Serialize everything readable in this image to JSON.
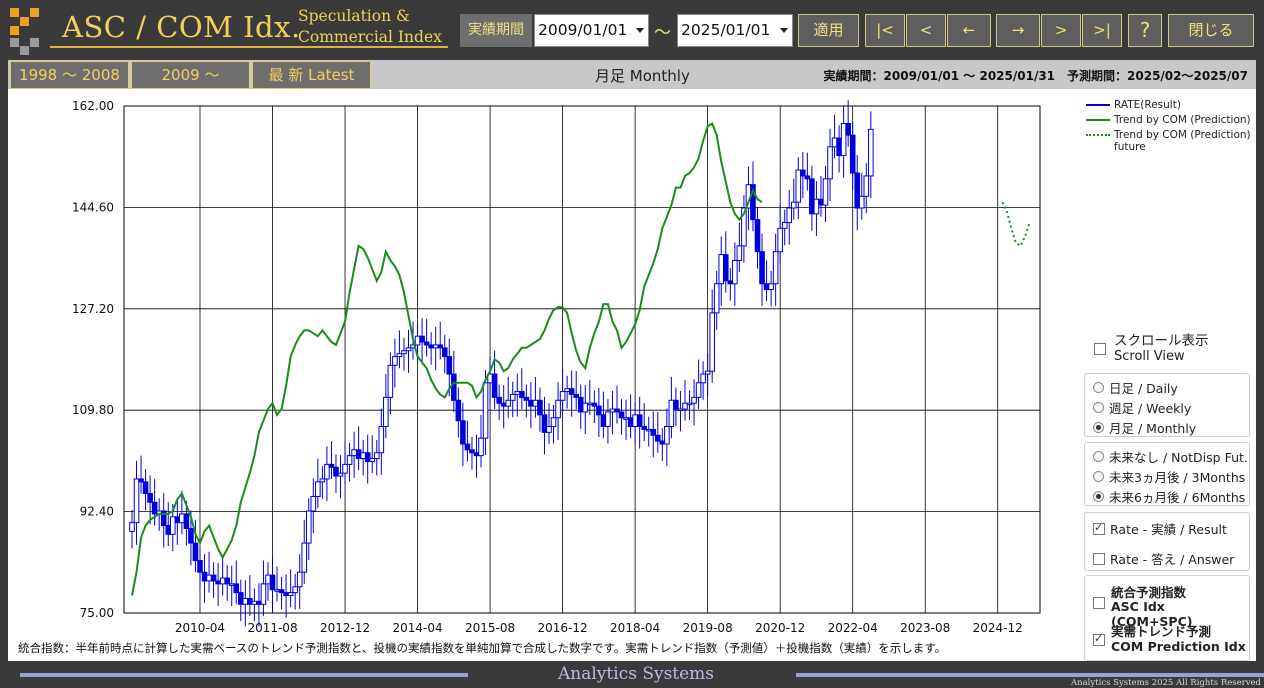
{
  "header": {
    "app_title": "ASC / COM Idx.",
    "subtitle_line1": "Speculation &",
    "subtitle_line2": "Commercial Index",
    "period_label": "実績期間",
    "start_date": "2009/01/01",
    "end_date": "2025/01/01",
    "tilde": "～",
    "apply_label": "適用",
    "nav_first": "|<",
    "nav_prev": "<",
    "nav_back": "←",
    "nav_forward": "→",
    "nav_next": ">",
    "nav_last": ">|",
    "help_label": "?",
    "close_label": "閉じる",
    "logo_colors": [
      "#f0a020",
      "#9a9a9a"
    ]
  },
  "toolbar": {
    "range1": "1998 ～ 2008",
    "range2": "2009 ～",
    "latest": "最 新  Latest",
    "view_label": "月足 Monthly",
    "period_info": "実績期間：2009/01/01 ～ 2025/01/31　予測期間：2025/02～2025/07"
  },
  "legend": {
    "rate": "RATE(Result)",
    "trend": "Trend by COM (Prediction)",
    "trend_future": "Trend by COM (Prediction) future"
  },
  "controls": {
    "scroll_jp": "スクロール表示",
    "scroll_en": "Scroll View",
    "daily": "日足 / Daily",
    "weekly": "週足 / Weekly",
    "monthly": "月足 / Monthly",
    "future_none": "未来なし / NotDisp Fut.",
    "future_3m": "未来3ヵ月後 / 3Months",
    "future_6m": "未来6ヵ月後 / 6Months",
    "rate_result": "Rate - 実績 / Result",
    "rate_answer": "Rate - 答え / Answer",
    "asc_jp": "統合予測指数",
    "asc_en": "ASC Idx (COM+SPC)",
    "com_jp": "実需トレンド予測",
    "com_en": "COM Prediction Idx",
    "scroll_checked": false,
    "period_selected": "monthly",
    "future_selected": "6m",
    "rate_result_checked": true,
    "rate_answer_checked": false,
    "asc_checked": false,
    "com_checked": true
  },
  "footnote": "統合指数：半年前時点に計算した実需ベースのトレンド予測指数と、投機の実績指数を単純加算で合成した数字です。実需トレンド指数（予測値）＋投機指数（実績）を示します。",
  "footer": {
    "company": "Analytics Systems",
    "copyright": "Analytics Systems 2025 All Rights Reserved"
  },
  "chart_data": {
    "type": "line",
    "y_ticks": [
      "162.00",
      "144.60",
      "127.20",
      "109.80",
      "92.40",
      "75.00"
    ],
    "ylim": [
      75,
      162
    ],
    "x_ticks": [
      "2010-04",
      "2011-08",
      "2012-12",
      "2014-04",
      "2015-08",
      "2016-12",
      "2018-04",
      "2019-08",
      "2020-12",
      "2022-04",
      "2023-08",
      "2024-12"
    ],
    "xlim": [
      "2009-01",
      "2025-07"
    ],
    "grid": true,
    "legend_position": "top-right",
    "rate_color": "#0000dd",
    "trend_color": "#1a8c1a",
    "rate_monthly": {
      "start": "2009-01",
      "close": [
        90.5,
        98.0,
        97.5,
        95.5,
        94.0,
        92.0,
        92.5,
        90.0,
        88.5,
        91.5,
        90.5,
        92.0,
        89.5,
        87.0,
        84.0,
        82.0,
        80.5,
        81.5,
        80.5,
        80.0,
        81.0,
        80.0,
        80.0,
        78.5,
        76.5,
        77.5,
        76.5,
        77.0,
        76.5,
        80.0,
        81.5,
        79.0,
        79.0,
        78.5,
        78.0,
        78.5,
        79.5,
        82.0,
        87.0,
        92.5,
        95.0,
        97.5,
        98.0,
        100.5,
        100.0,
        98.5,
        99.0,
        100.5,
        102.0,
        103.0,
        101.5,
        102.5,
        101.0,
        101.5,
        102.5,
        107.0,
        112.0,
        117.5,
        119.0,
        119.5,
        120.0,
        120.5,
        121.0,
        122.5,
        121.5,
        121.0,
        120.5,
        121.0,
        120.5,
        119.0,
        116.0,
        111.5,
        108.0,
        104.0,
        103.0,
        102.5,
        102.0,
        105.0,
        114.5,
        116.0,
        112.0,
        111.0,
        110.5,
        111.5,
        112.5,
        113.0,
        112.0,
        111.5,
        110.5,
        111.5,
        109.0,
        106.0,
        107.0,
        108.5,
        111.5,
        113.0,
        113.5,
        112.5,
        112.0,
        109.5,
        111.0,
        111.0,
        110.5,
        109.0,
        107.0,
        109.5,
        110.0,
        109.5,
        108.5,
        108.5,
        107.0,
        109.0,
        107.0,
        106.5,
        106.5,
        105.5,
        104.5,
        104.0,
        107.0,
        111.5,
        110.0,
        110.0,
        111.0,
        111.0,
        112.0,
        114.5,
        116.0,
        116.5,
        126.5,
        131.5,
        136.5,
        132.0,
        131.5,
        135.5,
        138.0,
        144.5,
        148.5,
        142.5,
        137.0,
        131.5,
        130.5,
        131.5,
        137.0,
        141.0,
        142.0,
        144.5,
        145.5,
        151.0,
        150.0,
        149.5,
        143.5,
        146.0,
        145.0,
        149.5,
        155.0,
        156.5,
        153.5,
        159.0,
        157.0,
        150.5,
        144.5,
        146.5,
        150.0,
        158.0
      ]
    },
    "trend_monthly": {
      "start": "2009-01",
      "values": [
        78.0,
        82.0,
        88.0,
        90.0,
        91.0,
        91.5,
        92.0,
        92.0,
        92.0,
        92.5,
        94.5,
        95.5,
        93.5,
        91.5,
        88.5,
        87.0,
        89.0,
        90.0,
        88.0,
        86.0,
        84.5,
        86.0,
        87.5,
        90.0,
        94.0,
        96.5,
        99.0,
        102.0,
        106.0,
        108.0,
        110.0,
        111.0,
        109.0,
        110.0,
        114.0,
        119.0,
        121.0,
        122.5,
        123.5,
        123.5,
        123.0,
        122.5,
        123.5,
        122.5,
        121.5,
        121.0,
        123.0,
        125.0,
        130.0,
        134.0,
        138.0,
        137.5,
        136.0,
        134.0,
        132.0,
        133.5,
        137.0,
        135.5,
        134.5,
        133.0,
        130.0,
        126.0,
        122.0,
        119.0,
        118.0,
        117.0,
        115.0,
        113.5,
        112.5,
        112.0,
        113.5,
        114.5,
        114.5,
        114.5,
        114.5,
        114.0,
        112.0,
        113.0,
        115.0,
        116.5,
        118.5,
        118.0,
        116.5,
        117.0,
        118.5,
        119.5,
        120.5,
        120.5,
        121.0,
        121.5,
        122.0,
        123.5,
        125.5,
        127.0,
        127.5,
        127.5,
        126.5,
        123.0,
        120.0,
        118.0,
        117.0,
        120.5,
        123.0,
        125.0,
        128.0,
        128.0,
        125.0,
        123.5,
        120.5,
        121.5,
        123.0,
        124.5,
        127.0,
        131.0,
        133.0,
        135.0,
        137.5,
        141.0,
        143.0,
        145.0,
        148.0,
        148.0,
        150.0,
        150.5,
        151.5,
        153.0,
        156.0,
        158.5,
        159.0,
        157.0,
        152.5,
        149.0,
        145.5,
        143.5,
        142.5,
        143.5,
        145.5,
        147.5,
        146.0,
        145.5
      ]
    },
    "trend_future": {
      "start": "2025-01",
      "values": [
        145.5,
        144.0,
        141.0,
        138.5,
        138.0,
        139.5,
        142.0
      ]
    }
  }
}
